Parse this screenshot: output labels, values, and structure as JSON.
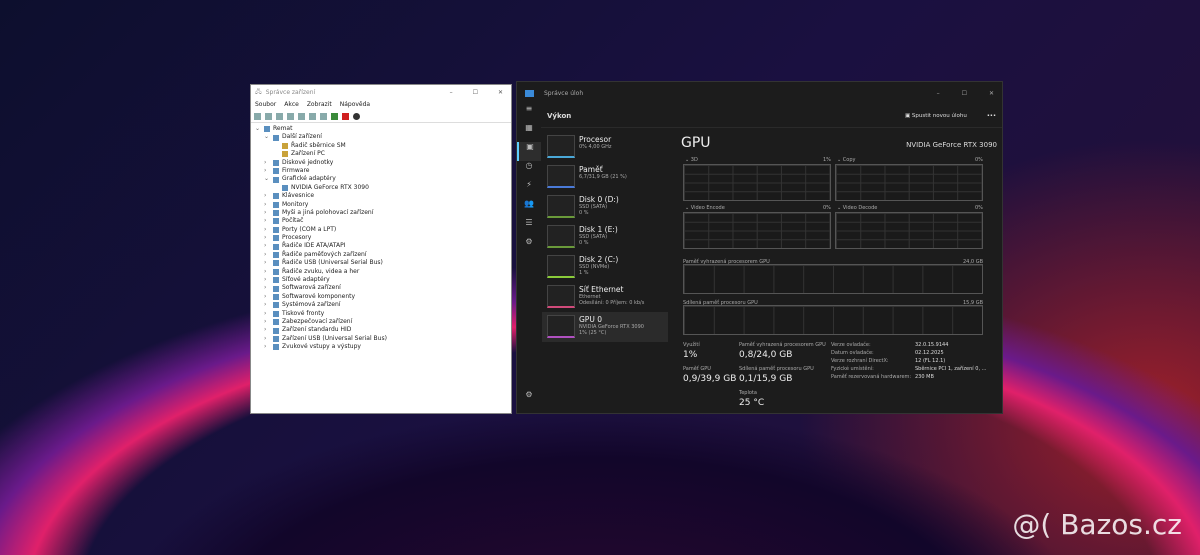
{
  "device_manager": {
    "title": "Správce zařízení",
    "menu": [
      "Soubor",
      "Akce",
      "Zobrazit",
      "Nápověda"
    ],
    "tree": [
      {
        "label": "Remat",
        "level": 0,
        "arrow": "v"
      },
      {
        "label": "Další zařízení",
        "level": 1,
        "arrow": "v"
      },
      {
        "label": "Řadič sběrnice SM",
        "level": 2,
        "arrow": ""
      },
      {
        "label": "Zařízení PC",
        "level": 2,
        "arrow": ""
      },
      {
        "label": "Diskové jednotky",
        "level": 1,
        "arrow": ">"
      },
      {
        "label": "Firmware",
        "level": 1,
        "arrow": ">"
      },
      {
        "label": "Grafické adaptéry",
        "level": 1,
        "arrow": "v"
      },
      {
        "label": "NVIDIA GeForce RTX 3090",
        "level": 2,
        "arrow": ""
      },
      {
        "label": "Klávesnice",
        "level": 1,
        "arrow": ">"
      },
      {
        "label": "Monitory",
        "level": 1,
        "arrow": ">"
      },
      {
        "label": "Myši a jiná polohovací zařízení",
        "level": 1,
        "arrow": ">"
      },
      {
        "label": "Počítač",
        "level": 1,
        "arrow": ">"
      },
      {
        "label": "Porty (COM a LPT)",
        "level": 1,
        "arrow": ">"
      },
      {
        "label": "Procesory",
        "level": 1,
        "arrow": ">"
      },
      {
        "label": "Řadiče IDE ATA/ATAPI",
        "level": 1,
        "arrow": ">"
      },
      {
        "label": "Řadiče paměťových zařízení",
        "level": 1,
        "arrow": ">"
      },
      {
        "label": "Řadiče USB (Universal Serial Bus)",
        "level": 1,
        "arrow": ">"
      },
      {
        "label": "Řadiče zvuku, videa a her",
        "level": 1,
        "arrow": ">"
      },
      {
        "label": "Síťové adaptéry",
        "level": 1,
        "arrow": ">"
      },
      {
        "label": "Softwarová zařízení",
        "level": 1,
        "arrow": ">"
      },
      {
        "label": "Softwarové komponenty",
        "level": 1,
        "arrow": ">"
      },
      {
        "label": "Systémová zařízení",
        "level": 1,
        "arrow": ">"
      },
      {
        "label": "Tiskové fronty",
        "level": 1,
        "arrow": ">"
      },
      {
        "label": "Zabezpečovací zařízení",
        "level": 1,
        "arrow": ">"
      },
      {
        "label": "Zařízení standardu HID",
        "level": 1,
        "arrow": ">"
      },
      {
        "label": "Zařízení USB (Universal Serial Bus)",
        "level": 1,
        "arrow": ">"
      },
      {
        "label": "Zvukové vstupy a výstupy",
        "level": 1,
        "arrow": ">"
      }
    ]
  },
  "task_manager": {
    "title": "Správce úloh",
    "section": "Výkon",
    "run_task": "Spustit novou úlohu",
    "list": [
      {
        "name": "Procesor",
        "sub1": "0% 4,00 GHz",
        "sub2": "",
        "color": "#4aa8d8"
      },
      {
        "name": "Paměť",
        "sub1": "6,7/31,9 GB (21 %)",
        "sub2": "",
        "color": "#4a7ad8"
      },
      {
        "name": "Disk 0 (D:)",
        "sub1": "SSD (SATA)",
        "sub2": "0 %",
        "color": "#6a9a3a"
      },
      {
        "name": "Disk 1 (E:)",
        "sub1": "SSD (SATA)",
        "sub2": "0 %",
        "color": "#6a9a3a"
      },
      {
        "name": "Disk 2 (C:)",
        "sub1": "SSD (NVMe)",
        "sub2": "1 %",
        "color": "#8acc3a"
      },
      {
        "name": "Síť Ethernet",
        "sub1": "Ethernet",
        "sub2": "Odesílání: 0 Příjem: 0 kb/s",
        "color": "#d04a7a"
      },
      {
        "name": "GPU 0",
        "sub1": "NVIDIA GeForce RTX 3090",
        "sub2": "1% (25 °C)",
        "color": "#b050c0"
      }
    ],
    "gpu": {
      "title": "GPU",
      "model": "NVIDIA GeForce RTX 3090",
      "engines": [
        {
          "name": "3D",
          "pct": "1%"
        },
        {
          "name": "Copy",
          "pct": "0%"
        },
        {
          "name": "Video Encode",
          "pct": "0%"
        },
        {
          "name": "Video Decode",
          "pct": "0%"
        }
      ],
      "dedicated_label": "Paměť vyhrazená procesorem GPU",
      "dedicated_max": "24,0 GB",
      "shared_label": "Sdílená paměť procesoru GPU",
      "shared_max": "15,9 GB",
      "stats": {
        "util_l": "Využití",
        "util": "1%",
        "mem_l": "Paměť GPU",
        "mem": "0,9/39,9 GB",
        "ded_l": "Paměť vyhrazená procesorem GPU",
        "ded": "0,8/24,0 GB",
        "sh_l": "Sdílená paměť procesoru GPU",
        "sh": "0,1/15,9 GB",
        "temp_l": "Teplota",
        "temp": "25 °C"
      },
      "info": [
        [
          "Verze ovladače:",
          "32.0.15.9144"
        ],
        [
          "Datum ovladače:",
          "02.12.2025"
        ],
        [
          "Verze rozhraní DirectX:",
          "12 (FL 12.1)"
        ],
        [
          "Fyzické umístění:",
          "Sběrnice PCI 1, zařízení 0, ..."
        ],
        [
          "Paměť rezervovaná hardwarem:",
          "230 MB"
        ]
      ]
    }
  },
  "watermark": "@( Bazos.cz"
}
